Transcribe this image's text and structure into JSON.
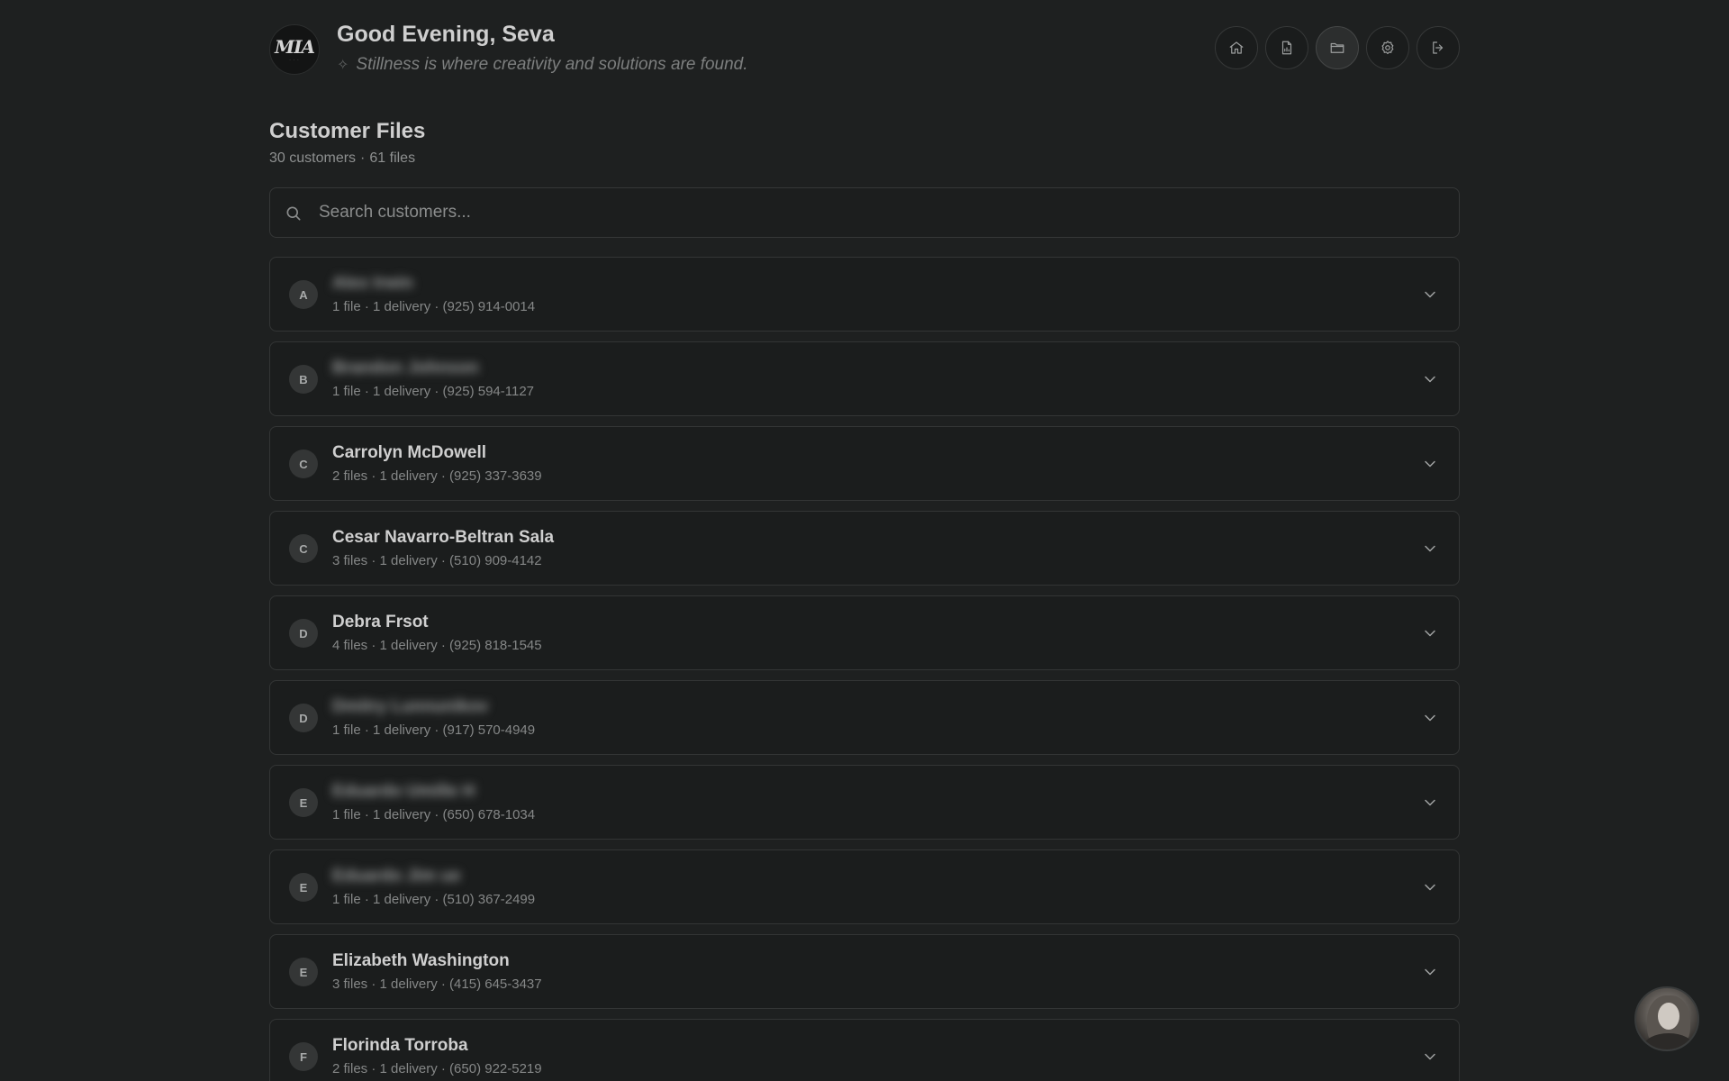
{
  "header": {
    "logo_text": "MIA",
    "greeting": "Good Evening, Seva",
    "quote_icon": "sparkle-icon",
    "quote": "Stillness is where creativity and solutions are found.",
    "nav": [
      {
        "name": "home",
        "icon": "home-icon"
      },
      {
        "name": "documents",
        "icon": "document-icon"
      },
      {
        "name": "files",
        "icon": "folder-icon",
        "active": true
      },
      {
        "name": "settings",
        "icon": "gear-icon"
      },
      {
        "name": "logout",
        "icon": "logout-icon"
      }
    ]
  },
  "page": {
    "title": "Customer Files",
    "customers_count": "30 customers",
    "separator": "·",
    "files_count": "61 files"
  },
  "search": {
    "placeholder": "Search customers...",
    "value": ""
  },
  "customers": [
    {
      "initial": "A",
      "name": "Alex Irwin",
      "blurred": true,
      "meta": "1 file · 1 delivery · (925) 914-0014"
    },
    {
      "initial": "B",
      "name": "Brandon Johnson",
      "blurred": true,
      "meta": "1 file · 1 delivery · (925) 594-1127"
    },
    {
      "initial": "C",
      "name": "Carrolyn McDowell",
      "blurred": false,
      "meta": "2 files · 1 delivery · (925) 337-3639"
    },
    {
      "initial": "C",
      "name": "Cesar Navarro-Beltran Sala",
      "blurred": false,
      "meta": "3 files · 1 delivery · (510) 909-4142"
    },
    {
      "initial": "D",
      "name": "Debra Frsot",
      "blurred": false,
      "meta": "4 files · 1 delivery · (925) 818-1545"
    },
    {
      "initial": "D",
      "name": "Dmitry Lunnunikov",
      "blurred": true,
      "meta": "1 file · 1 delivery · (917) 570-4949"
    },
    {
      "initial": "E",
      "name": "Eduardo Umille H",
      "blurred": true,
      "meta": "1 file · 1 delivery · (650) 678-1034"
    },
    {
      "initial": "E",
      "name": "Eduardo Jim ue",
      "blurred": true,
      "meta": "1 file · 1 delivery · (510) 367-2499"
    },
    {
      "initial": "E",
      "name": "Elizabeth Washington",
      "blurred": false,
      "meta": "3 files · 1 delivery · (415) 645-3437"
    },
    {
      "initial": "F",
      "name": "Florinda Torroba",
      "blurred": false,
      "meta": "2 files · 1 delivery · (650) 922-5219"
    }
  ],
  "assistant": {
    "icon": "assistant-avatar"
  }
}
